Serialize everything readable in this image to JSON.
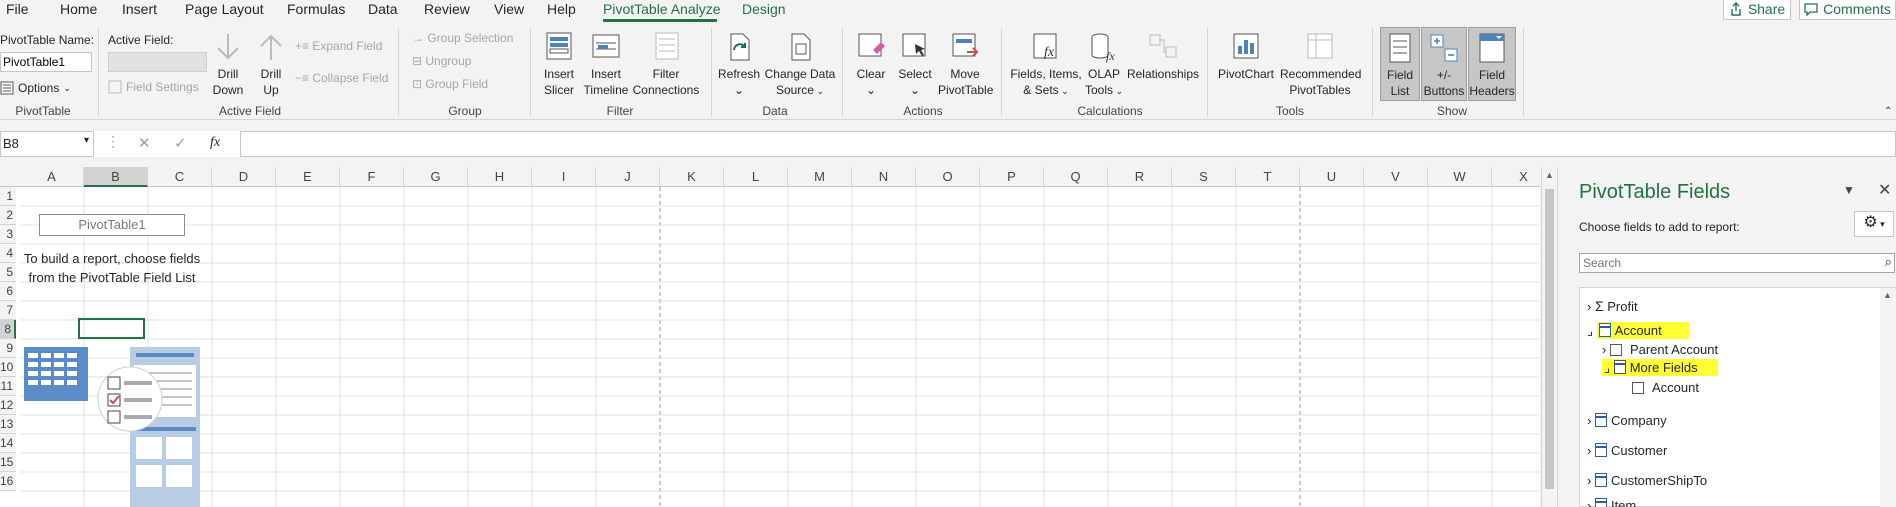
{
  "tabs": [
    {
      "label": "File"
    },
    {
      "label": "Home"
    },
    {
      "label": "Insert"
    },
    {
      "label": "Page Layout"
    },
    {
      "label": "Formulas"
    },
    {
      "label": "Data"
    },
    {
      "label": "Review"
    },
    {
      "label": "View"
    },
    {
      "label": "Help"
    },
    {
      "label": "PivotTable Analyze"
    },
    {
      "label": "Design"
    }
  ],
  "share": "Share",
  "comments": "Comments",
  "ribbon": {
    "pivottable": {
      "name_label": "PivotTable Name:",
      "name_value": "PivotTable1",
      "options": "Options",
      "group": "PivotTable"
    },
    "active_field": {
      "label": "Active Field:",
      "field_settings": "Field Settings",
      "drill_down_1": "Drill",
      "drill_down_2": "Down",
      "drill_up_1": "Drill",
      "drill_up_2": "Up",
      "expand": "Expand Field",
      "collapse": "Collapse Field",
      "group": "Active Field"
    },
    "group": {
      "group_selection": "Group Selection",
      "ungroup": "Ungroup",
      "group_field": "Group Field",
      "group": "Group"
    },
    "filter": {
      "slicer_1": "Insert",
      "slicer_2": "Slicer",
      "timeline_1": "Insert",
      "timeline_2": "Timeline",
      "conn_1": "Filter",
      "conn_2": "Connections",
      "group": "Filter"
    },
    "data": {
      "refresh": "Refresh",
      "change_1": "Change Data",
      "change_2": "Source",
      "group": "Data"
    },
    "actions": {
      "clear": "Clear",
      "select": "Select",
      "move_1": "Move",
      "move_2": "PivotTable",
      "group": "Actions"
    },
    "calculations": {
      "fields_1": "Fields, Items,",
      "fields_2": "& Sets",
      "olap_1": "OLAP",
      "olap_2": "Tools",
      "relationships": "Relationships",
      "group": "Calculations"
    },
    "tools": {
      "pivotchart": "PivotChart",
      "rec_1": "Recommended",
      "rec_2": "PivotTables",
      "group": "Tools"
    },
    "show": {
      "field_list_1": "Field",
      "field_list_2": "List",
      "buttons_1": "+/-",
      "buttons_2": "Buttons",
      "headers_1": "Field",
      "headers_2": "Headers",
      "group": "Show"
    }
  },
  "formula_bar": {
    "name_box": "B8",
    "fx": "fx",
    "content": ""
  },
  "columns": [
    "A",
    "B",
    "C",
    "D",
    "E",
    "F",
    "G",
    "H",
    "I",
    "J",
    "K",
    "L",
    "M",
    "N",
    "O",
    "P",
    "Q",
    "R",
    "S",
    "T",
    "U",
    "V",
    "W",
    "X"
  ],
  "rows": [
    "1",
    "2",
    "3",
    "4",
    "5",
    "6",
    "7",
    "8",
    "9",
    "10",
    "11",
    "12",
    "13",
    "14",
    "15",
    "16"
  ],
  "pivot_placeholder": {
    "title": "PivotTable1",
    "instruction": "To build a report, choose fields from the PivotTable Field List"
  },
  "pane": {
    "title": "PivotTable Fields",
    "subtitle": "Choose fields to add to report:",
    "search_placeholder": "Search",
    "fields": {
      "profit": "Profit",
      "account": "Account",
      "parent_account": "Parent Account",
      "more_fields": "More Fields",
      "account_child": "Account",
      "company": "Company",
      "customer": "Customer",
      "customer_ship_to": "CustomerShipTo",
      "item": "Item"
    }
  },
  "colors": {
    "accent": "#217346",
    "highlight": "#ffff33",
    "table_icon": "#2e5ea8"
  }
}
